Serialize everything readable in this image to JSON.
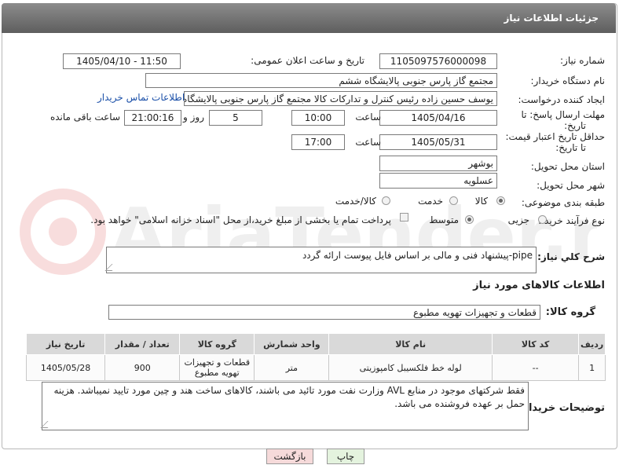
{
  "header": {
    "title": "جزئیات اطلاعات نیاز"
  },
  "fields": {
    "need_number_label": "شماره نیاز:",
    "need_number_value": "1105097576000098",
    "announce_label": "تاریخ و ساعت اعلان عمومی:",
    "announce_value": "1405/04/10 - 11:50",
    "buyer_org_label": "نام دستگاه خریدار:",
    "buyer_org_value": "مجتمع گاز پارس جنوبی  پالایشگاه ششم",
    "creator_label": "ایجاد کننده درخواست:",
    "creator_value": "یوسف حسین زاده رئیس کنترل و تدارکات کالا مجتمع گاز پارس جنوبی  پالایشگاه",
    "contact_link": "اطلاعات تماس خریدار",
    "deadline_label_1": "مهلت ارسال پاسخ: تا",
    "deadline_label_2": "تاریخ:",
    "deadline_date": "1405/04/16",
    "time_label": "ساعت",
    "deadline_time": "10:00",
    "days_value": "5",
    "days_label": "روز و",
    "remaining_time": "21:00:16",
    "remaining_label": "ساعت باقی مانده",
    "min_validity_label_1": "حداقل تاریخ اعتبار قیمت:",
    "min_validity_label_2": "تا تاریخ:",
    "validity_date": "1405/05/31",
    "validity_time": "17:00",
    "province_label": "استان محل تحویل:",
    "province_value": "بوشهر",
    "city_label": "شهر محل تحویل:",
    "city_value": "عسلویه",
    "category_label": "طبقه بندی موضوعی:",
    "category_options": [
      "کالا",
      "خدمت",
      "کالا/خدمت"
    ],
    "process_label": "نوع فرآیند خرید :",
    "process_options": [
      "جزیی",
      "متوسط"
    ],
    "payment_note": "پرداخت تمام یا بخشی از مبلغ خرید،از محل \"اسناد خزانه اسلامی\" خواهد بود."
  },
  "description": {
    "label": "شرح كلي نياز:",
    "value": "pipe-پیشنهاد فنی و مالی بر اساس فایل پیوست ارائه گردد"
  },
  "goods_section": {
    "title": "اطلاعات کالاهای مورد نیاز",
    "group_label": "گروه کالا:",
    "group_value": "قطعات و تجهیزات تهویه مطبوع"
  },
  "table": {
    "headers": [
      "ردیف",
      "کد کالا",
      "نام کالا",
      "واحد شمارش",
      "گروه کالا",
      "تعداد / مقدار",
      "تاریخ نیاز"
    ],
    "rows": [
      [
        "1",
        "--",
        "لوله خط فلکسیبل کامپوزیتی",
        "متر",
        "قطعات و تجهیزات تهویه مطبوع",
        "900",
        "1405/05/28"
      ]
    ]
  },
  "buyer_notes": {
    "label": "توضیحات خریدار:",
    "value": "فقط شرکتهای موجود در منابع AVL وزارت نفت مورد تائید می باشند، کالاهای ساخت هند و چین مورد تایید نمیباشد. هزینه حمل بر عهده فروشنده می باشد."
  },
  "buttons": {
    "print": "چاپ",
    "back": "بازگشت"
  },
  "watermark": "AriaTender.neT",
  "colors": {
    "header": "#6e6e6e",
    "link": "#1a4fa8",
    "back_button": "#f6dada",
    "print_button": "#e4f3de"
  }
}
